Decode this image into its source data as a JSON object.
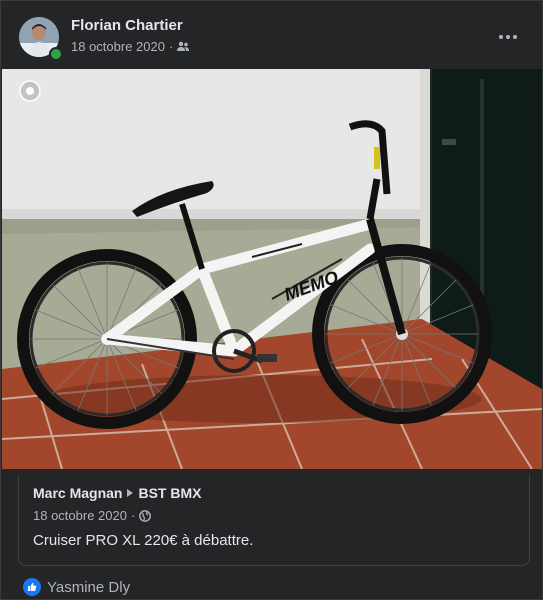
{
  "post": {
    "author": "Florian Chartier",
    "date": "18 octobre 2020",
    "separator": "·",
    "privacy_icon": "group-icon"
  },
  "shared_post": {
    "author": "Marc Magnan",
    "group": "BST BMX",
    "date": "18 octobre 2020",
    "separator": "·",
    "privacy_icon": "globe-icon",
    "text": "Cruiser PRO XL 220€ à débattre."
  },
  "reactions": {
    "icon": "like-icon",
    "names": "Yasmine Dly"
  },
  "colors": {
    "background": "#242526",
    "accent": "#1877f2",
    "online": "#31a24c"
  }
}
